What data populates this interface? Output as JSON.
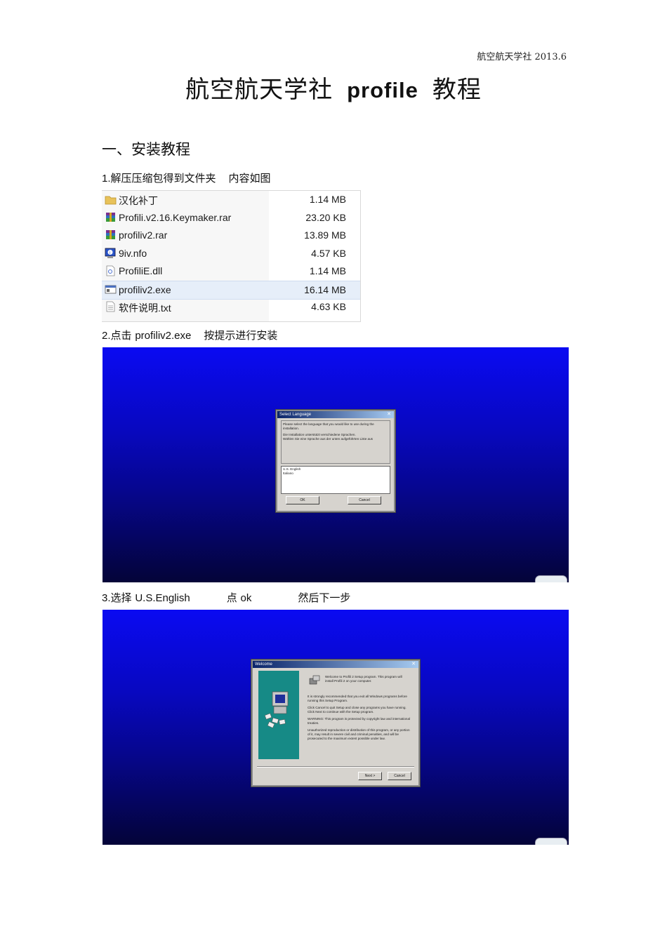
{
  "header": {
    "right_text": "航空航天学社 2013.6"
  },
  "title": {
    "pre": "航空航天学社",
    "bold": "profile",
    "post": "教程"
  },
  "section1": {
    "heading": "一、安装教程"
  },
  "steps": [
    {
      "num": "1.",
      "text_a": "解压压缩包得到文件夹",
      "text_b": "内容如图"
    },
    {
      "num": "2.",
      "text_a": "点击",
      "latin": "profiliv2.exe",
      "text_b": "按提示进行安装"
    },
    {
      "num": "3.",
      "text_a": "选择",
      "latin": "U.S.English",
      "text_b": "点",
      "latin2": "ok",
      "text_c": "然后下一步"
    }
  ],
  "files": [
    {
      "icon": "folder-icon",
      "name": "汉化补丁",
      "size": "1.14 MB"
    },
    {
      "icon": "rar-archive-icon",
      "name": "Profili.v2.16.Keymaker.rar",
      "size": "23.20 KB"
    },
    {
      "icon": "rar-archive-icon",
      "name": "profiliv2.rar",
      "size": "13.89 MB"
    },
    {
      "icon": "nfo-file-icon",
      "name": "9iv.nfo",
      "size": "4.57 KB"
    },
    {
      "icon": "dll-file-icon",
      "name": "ProfiliE.dll",
      "size": "1.14 MB"
    },
    {
      "icon": "exe-file-icon",
      "name": "profiliv2.exe",
      "size": "16.14 MB",
      "selected": true
    },
    {
      "icon": "text-file-icon",
      "name": "软件说明.txt",
      "size": "4.63 KB"
    }
  ],
  "dialog1": {
    "title": "Select Language",
    "lines": [
      "Please select the language that you would like to use during the installation.",
      "Die Installation unterstützt verschiedene Sprachen.",
      "Wählen Sie eine Sprache aus der unten aufgeführten Liste aus"
    ],
    "options": [
      "U.S. English",
      "Italiano"
    ],
    "ok": "OK",
    "cancel": "Cancel"
  },
  "dialog2": {
    "title": "Welcome",
    "intro": "Welcome to Profili 2 Setup program. This program will install Profili 2 on your computer.",
    "paras": [
      "It is strongly recommended that you exit all Windows programs before running this Setup Program.",
      "Click Cancel to quit Setup and close any programs you have running. Click Next to continue with the Setup program.",
      "WARNING: This program is protected by copyright law and international treaties.",
      "Unauthorized reproduction or distribution of this program, or any portion of it, may result in severe civil and criminal penalties, and will be prosecuted to the maximum extent possible under law."
    ],
    "next": "Next >",
    "cancel": "Cancel"
  },
  "colors": {
    "screen_blue": "#0a0af2",
    "screen_dark": "#040438",
    "dialog_gray": "#d6d3ce",
    "setup_panel_teal": "#168a86"
  }
}
